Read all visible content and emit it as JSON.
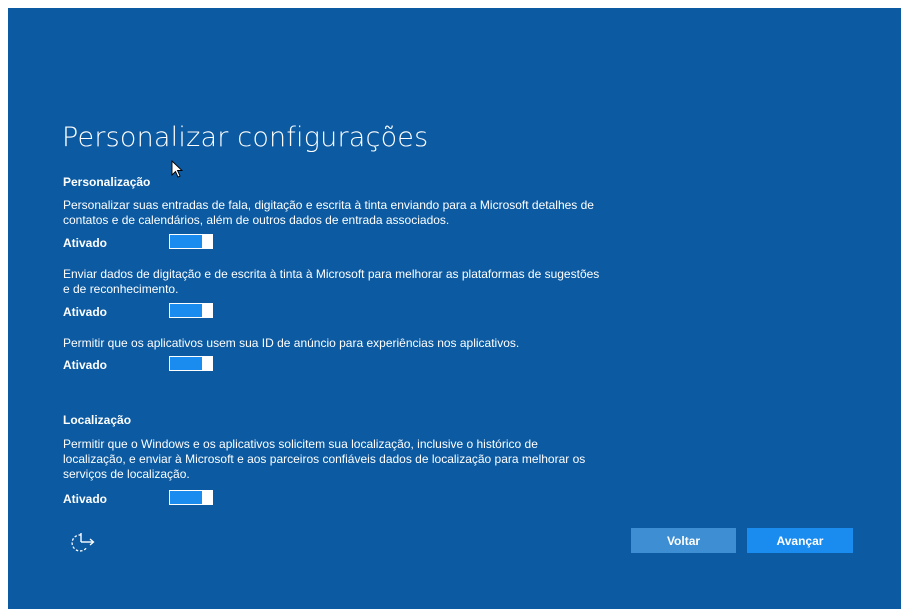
{
  "title": "Personalizar configurações",
  "sections": [
    {
      "heading": "Personalização",
      "settings": [
        {
          "line1": "Personalizar suas entradas de fala, digitação e escrita à tinta enviando para a Microsoft detalhes de",
          "line2": "contatos e de calendários, além de outros dados de entrada associados.",
          "state": "Ativado",
          "enabled": true
        },
        {
          "line1": "Enviar dados de digitação e de escrita à tinta à Microsoft para melhorar as plataformas de sugestões",
          "line2": "e de reconhecimento.",
          "state": "Ativado",
          "enabled": true
        },
        {
          "line1": "Permitir que os aplicativos usem sua ID de anúncio para experiências nos aplicativos.",
          "state": "Ativado",
          "enabled": true
        }
      ]
    },
    {
      "heading": "Localização",
      "settings": [
        {
          "line1": "Permitir que o Windows e os aplicativos solicitem sua localização, inclusive o histórico de",
          "line2": "localização, e enviar à Microsoft e aos parceiros confiáveis dados de localização para melhorar os",
          "line3": "serviços de localização.",
          "state": "Ativado",
          "enabled": true
        }
      ]
    }
  ],
  "buttons": {
    "back": "Voltar",
    "next": "Avançar"
  },
  "icons": {
    "accessibility": "ease-of-access-icon",
    "cursor": "mouse-pointer-icon"
  },
  "colors": {
    "background": "#0b5aa2",
    "accent": "#1a8cf0",
    "back_button": "#3d8ed3",
    "text": "#ffffff"
  }
}
